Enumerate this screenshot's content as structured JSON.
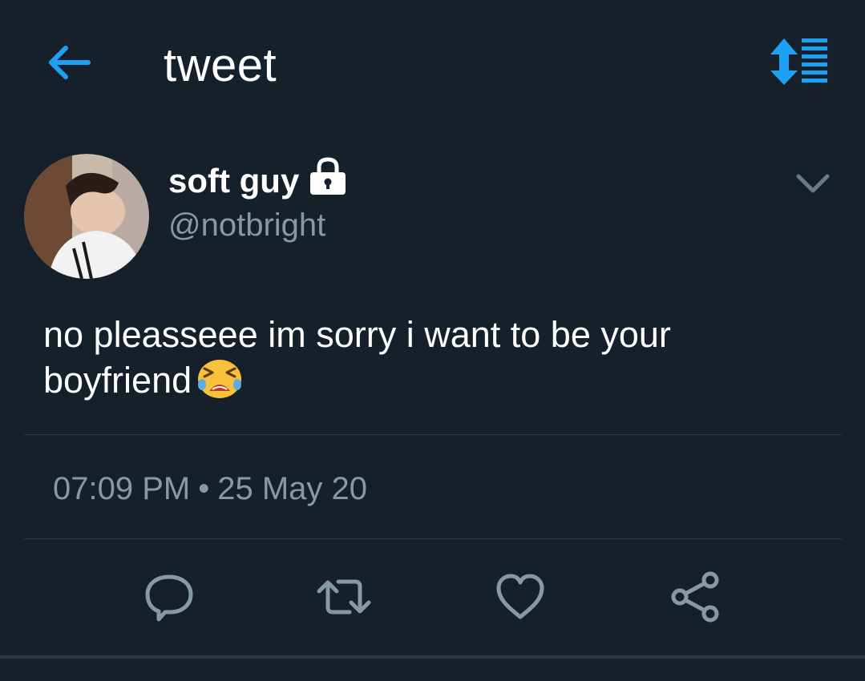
{
  "header": {
    "title": "tweet",
    "back_icon": "arrow-left-icon",
    "thread_icon": "sort-thread-icon",
    "accent_color": "#1da1f2"
  },
  "tweet": {
    "author": {
      "display_name": "soft guy",
      "handle": "@notbright",
      "protected_icon": "lock-icon",
      "avatar": "avatar-photo"
    },
    "text_lines": [
      "no pleasseee im sorry i want to be your",
      "boyfriend"
    ],
    "emoji": "tired-face-crying-emoji",
    "time": "07:09 PM",
    "separator": "•",
    "date": "25 May 20"
  },
  "actions": [
    {
      "name": "reply",
      "icon": "reply-icon"
    },
    {
      "name": "retweet",
      "icon": "retweet-icon"
    },
    {
      "name": "like",
      "icon": "heart-icon"
    },
    {
      "name": "share",
      "icon": "share-icon"
    }
  ],
  "colors": {
    "background": "#16202b",
    "muted_text": "#8899a6",
    "divider": "#2c3743",
    "icon_gray": "#8899a6"
  }
}
